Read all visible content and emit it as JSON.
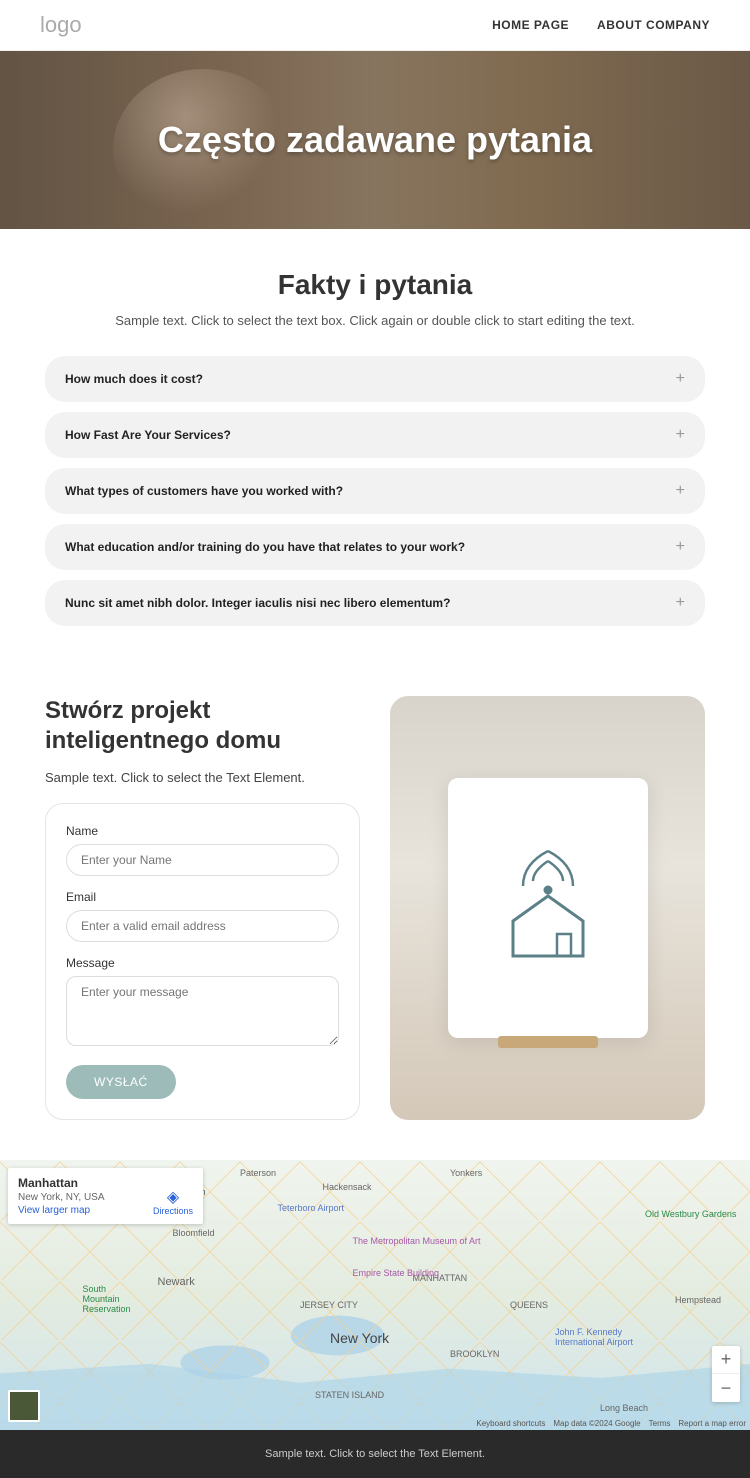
{
  "header": {
    "logo": "logo",
    "nav": [
      {
        "label": "HOME PAGE"
      },
      {
        "label": "ABOUT COMPANY"
      }
    ]
  },
  "hero": {
    "title": "Często zadawane pytania"
  },
  "faq": {
    "title": "Fakty i pytania",
    "subtitle": "Sample text. Click to select the text box. Click again or double click to start editing the text.",
    "items": [
      {
        "question": "How much does it cost?"
      },
      {
        "question": "How Fast Are Your Services?"
      },
      {
        "question": "What types of customers have you worked with?"
      },
      {
        "question": "What education and/or training do you have that relates to your work?"
      },
      {
        "question": "Nunc sit amet nibh dolor. Integer iaculis nisi nec libero elementum?"
      }
    ]
  },
  "contact": {
    "title": "Stwórz projekt inteligentnego domu",
    "subtitle": "Sample text. Click to select the Text Element.",
    "form": {
      "name_label": "Name",
      "name_placeholder": "Enter your Name",
      "email_label": "Email",
      "email_placeholder": "Enter a valid email address",
      "message_label": "Message",
      "message_placeholder": "Enter your message",
      "submit": "WYSŁAĆ"
    }
  },
  "map": {
    "info_title": "Manhattan",
    "info_addr": "New York, NY, USA",
    "larger": "View larger map",
    "directions": "Directions",
    "labels": {
      "ny": "New York",
      "brooklyn": "BROOKLYN",
      "queens": "QUEENS",
      "manhattan": "MANHATTAN",
      "jersey": "JERSEY CITY",
      "newark": "Newark",
      "bloomfield": "Bloomfield",
      "clifton": "Clifton",
      "paterson": "Paterson",
      "hackensack": "Hackensack",
      "yonkers": "Yonkers",
      "met": "The Metropolitan Museum of Art",
      "empire": "Empire State Building",
      "long_beach": "Long Beach",
      "hempstead": "Hempstead",
      "westbury": "Old Westbury Gardens",
      "teterboro": "Teterboro Airport",
      "jfk": "John F. Kennedy International Airport",
      "s_mountain": "South Mountain Reservation",
      "staten": "STATEN ISLAND",
      "kb_shortcuts": "Keyboard shortcuts",
      "map_data": "Map data ©2024 Google",
      "terms": "Terms",
      "report": "Report a map error"
    }
  },
  "footer": {
    "text": "Sample text. Click to select the Text Element."
  }
}
